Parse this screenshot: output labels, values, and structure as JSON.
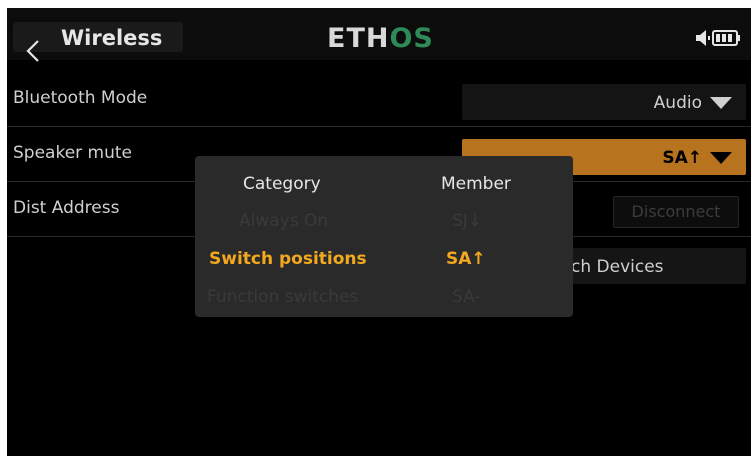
{
  "header": {
    "title": "Wireless",
    "logo_main": "ETH",
    "logo_accent": "OS"
  },
  "rows": [
    {
      "label": "Bluetooth Mode",
      "value": "Audio"
    },
    {
      "label": "Speaker mute",
      "value": "SA↑"
    },
    {
      "label": "Dist Address",
      "button": "Disconnect"
    }
  ],
  "search_button": {
    "label": "ch Devices"
  },
  "popup": {
    "category_header": "Category",
    "member_header": "Member",
    "categories": [
      "Always On",
      "Switch positions",
      "Function switches"
    ],
    "members": [
      "SJ↓",
      "SA↑",
      "SA-"
    ],
    "selected_index": 1
  },
  "colors": {
    "accent": "#f2a81f",
    "active_field": "#b8731f",
    "logo_accent": "#2e8b57"
  }
}
